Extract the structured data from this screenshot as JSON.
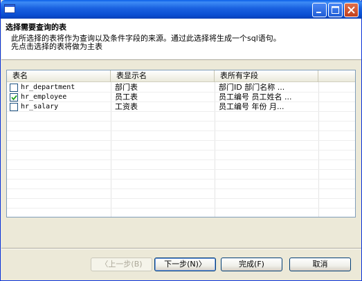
{
  "window": {
    "minimize_icon": "minimize-icon",
    "maximize_icon": "maximize-icon",
    "close_icon": "close-icon"
  },
  "header": {
    "title": "选择需要查询的表",
    "desc_line1": "此所选择的表将作为查询以及条件字段的来源。通过此选择将生成一个sql语句。",
    "desc_line2": "先点击选择的表将做为主表"
  },
  "table": {
    "columns": [
      "表名",
      "表显示名",
      "表所有字段"
    ],
    "rows": [
      {
        "name": "hr_department",
        "display": "部门表",
        "fields": "部门ID    部门名称    ...",
        "checked": false
      },
      {
        "name": "hr_employee",
        "display": "员工表",
        "fields": "员工编号    员工姓名 ...",
        "checked": true
      },
      {
        "name": "hr_salary",
        "display": "工资表",
        "fields": "员工编号    年份    月...",
        "checked": false
      }
    ]
  },
  "buttons": {
    "back": "〈上一步(B)",
    "next": "下一步(N)〉",
    "finish": "完成(F)",
    "cancel": "取消"
  },
  "colors": {
    "titlebar": "#0a4fd3",
    "dialog_bg": "#ece9d8",
    "border": "#7f9db9"
  }
}
